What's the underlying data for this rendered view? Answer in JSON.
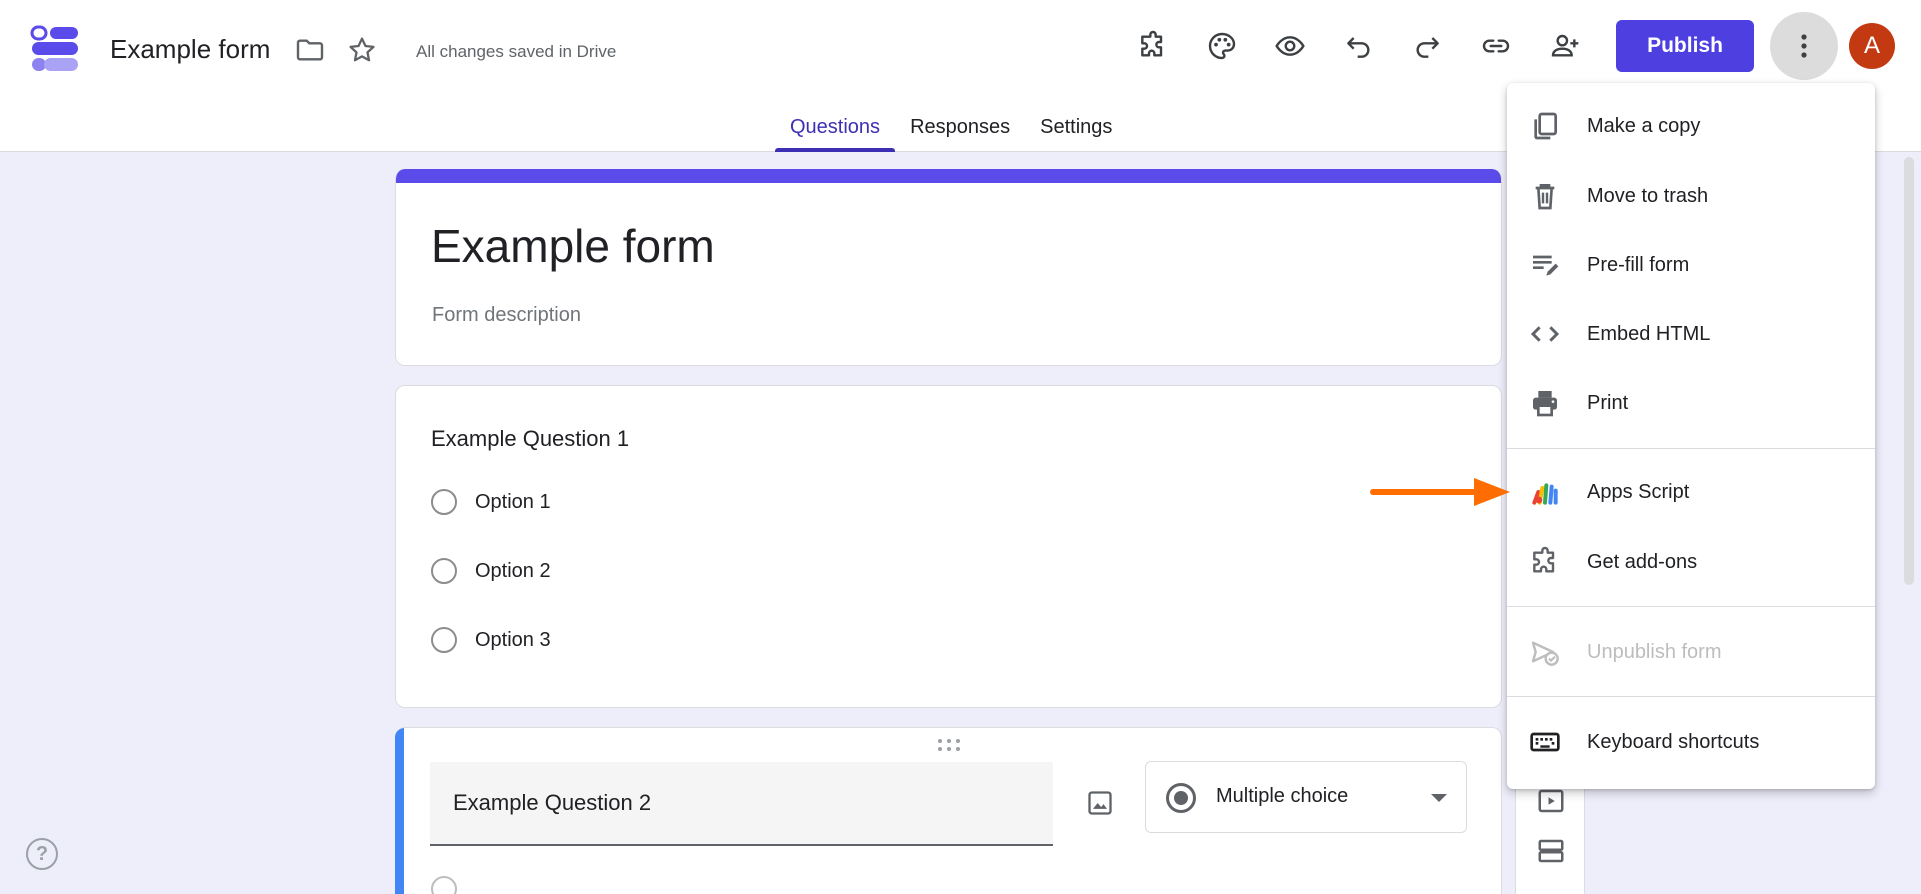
{
  "header": {
    "title": "Example form",
    "saved_status": "All changes saved in Drive",
    "publish_label": "Publish",
    "avatar_letter": "A"
  },
  "tabs": [
    {
      "label": "Questions",
      "active": true
    },
    {
      "label": "Responses",
      "active": false
    },
    {
      "label": "Settings",
      "active": false
    }
  ],
  "form": {
    "title": "Example form",
    "description_placeholder": "Form description",
    "question1": {
      "title": "Example Question 1",
      "options": [
        "Option 1",
        "Option 2",
        "Option 3"
      ]
    },
    "question2": {
      "title": "Example Question 2",
      "type": "Multiple choice"
    }
  },
  "menu": {
    "items": [
      {
        "label": "Make a copy",
        "icon": "copy-icon"
      },
      {
        "label": "Move to trash",
        "icon": "trash-icon"
      },
      {
        "label": "Pre-fill form",
        "icon": "prefill-icon"
      },
      {
        "label": "Embed HTML",
        "icon": "code-icon"
      },
      {
        "label": "Print",
        "icon": "print-icon"
      },
      {
        "label": "Apps Script",
        "icon": "apps-script-icon"
      },
      {
        "label": "Get add-ons",
        "icon": "addons-icon"
      },
      {
        "label": "Unpublish form",
        "icon": "unpublish-icon",
        "disabled": true
      },
      {
        "label": "Keyboard shortcuts",
        "icon": "keyboard-icon"
      }
    ]
  },
  "colors": {
    "accent": "#4d3fe0",
    "tab_active": "#3c2fb4",
    "background": "#eeeefb",
    "annotation_arrow": "#ff6d00",
    "avatar": "#c33a12"
  }
}
